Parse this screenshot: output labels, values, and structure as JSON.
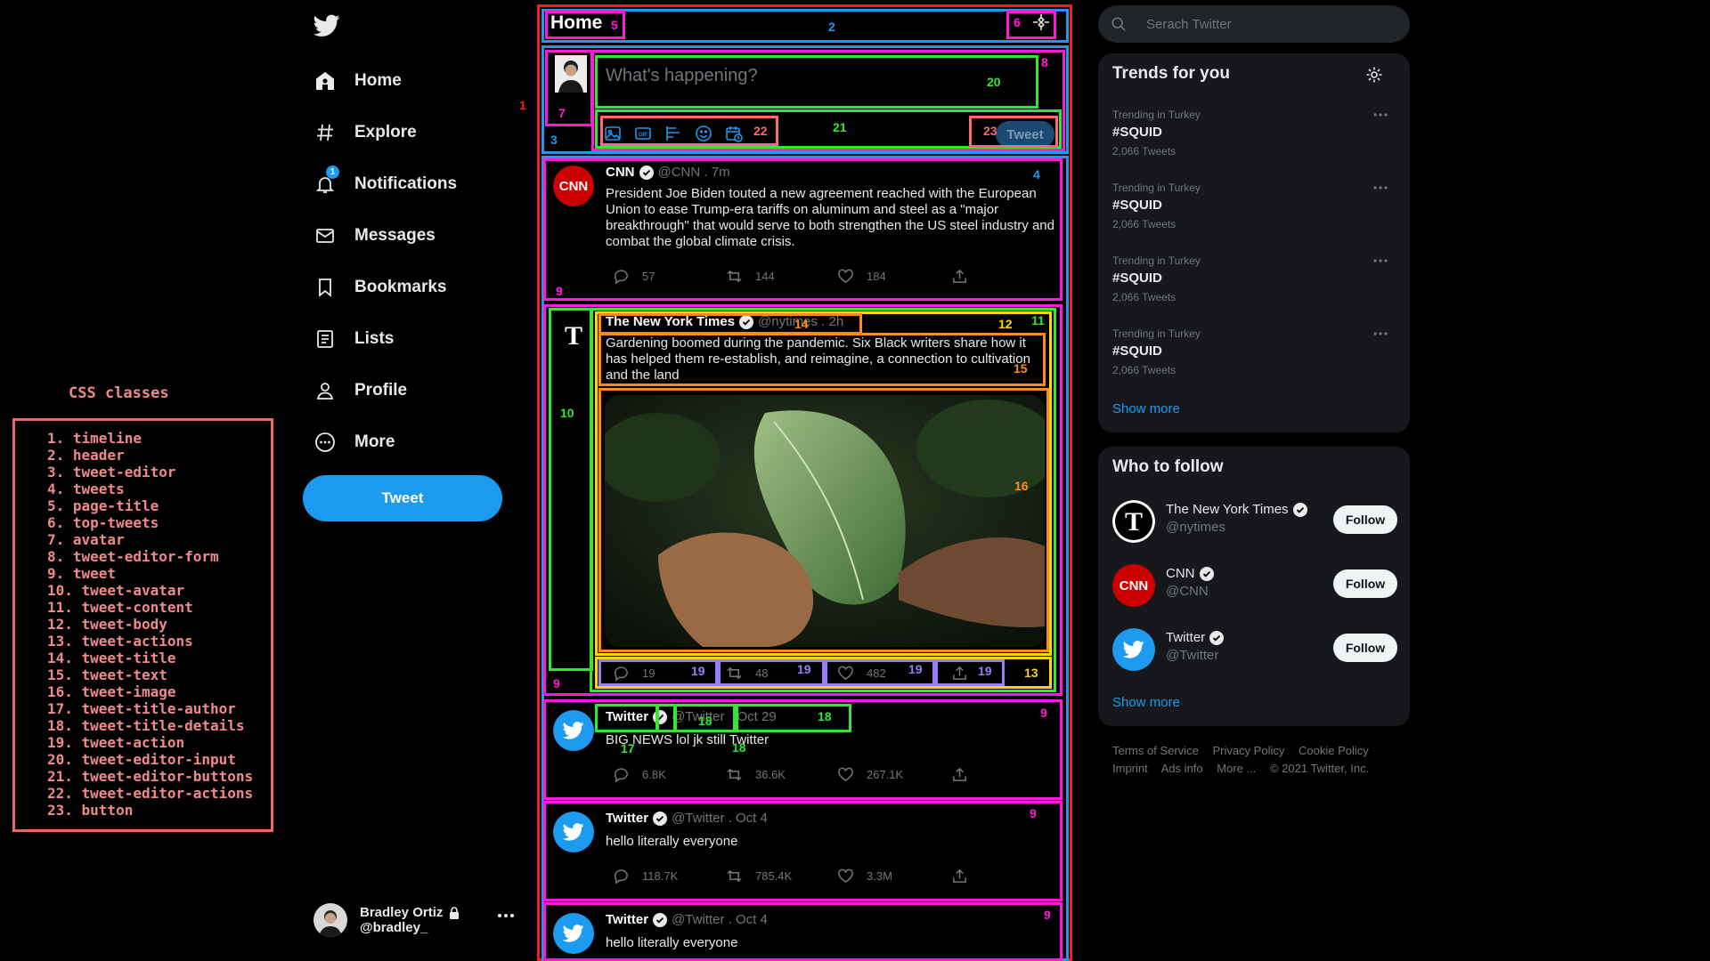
{
  "legend": {
    "title": "CSS classes",
    "items": [
      "1. timeline",
      "2. header",
      "3. tweet-editor",
      "4. tweets",
      "5. page-title",
      "6. top-tweets",
      "7. avatar",
      "8. tweet-editor-form",
      "9. tweet",
      "10. tweet-avatar",
      "11. tweet-content",
      "12. tweet-body",
      "13. tweet-actions",
      "14. tweet-title",
      "15. tweet-text",
      "16. tweet-image",
      "17. tweet-title-author",
      "18. tweet-title-details",
      "19. tweet-action",
      "20. tweet-editor-input",
      "21. tweet-editor-buttons",
      "22. tweet-editor-actions",
      "23. button"
    ]
  },
  "nav": {
    "items": [
      {
        "label": "Home",
        "icon": "home-icon"
      },
      {
        "label": "Explore",
        "icon": "hashtag-icon"
      },
      {
        "label": "Notifications",
        "icon": "bell-icon",
        "badge": "1"
      },
      {
        "label": "Messages",
        "icon": "envelope-icon"
      },
      {
        "label": "Bookmarks",
        "icon": "bookmark-icon"
      },
      {
        "label": "Lists",
        "icon": "list-icon"
      },
      {
        "label": "Profile",
        "icon": "person-icon"
      },
      {
        "label": "More",
        "icon": "more-circle-icon"
      }
    ],
    "tweet_button": "Tweet"
  },
  "account": {
    "name": "Bradley Ortiz",
    "handle": "@bradley_"
  },
  "header": {
    "title": "Home"
  },
  "editor": {
    "placeholder": "What's happening?",
    "tweet_button": "Tweet"
  },
  "tweets": [
    {
      "author": "CNN",
      "handle": "@CNN . 7m",
      "text": "President Joe Biden touted a new agreement reached with the European Union to ease Trump-era tariffs on aluminum and steel as a \"major breakthrough\" that would serve to both strengthen the US steel industry and combat the global climate crisis.",
      "replies": "57",
      "retweets": "144",
      "likes": "184"
    },
    {
      "author": "The New York Times",
      "handle": "@nytimes . 2h",
      "text": "Gardening boomed during the pandemic. Six Black writers share how it has helped them re-establish, and reimagine, a connection to cultivation and the land",
      "replies": "19",
      "retweets": "48",
      "likes": "482"
    },
    {
      "author": "Twitter",
      "handle": "@Twitter",
      "date": "Oct 29",
      "text": "BIG NEWS lol jk still Twitter",
      "replies": "6.8K",
      "retweets": "36.6K",
      "likes": "267.1K"
    },
    {
      "author": "Twitter",
      "handle": "@Twitter . Oct 4",
      "text": "hello literally everyone",
      "replies": "118.7K",
      "retweets": "785.4K",
      "likes": "3.3M"
    },
    {
      "author": "Twitter",
      "handle": "@Twitter . Oct 4",
      "text": "hello literally everyone"
    }
  ],
  "search": {
    "placeholder": "Serach Twitter"
  },
  "trends": {
    "title": "Trends for you",
    "items": [
      {
        "context": "Trending in Turkey",
        "tag": "#SQUID",
        "count": "2,066 Tweets"
      },
      {
        "context": "Trending in Turkey",
        "tag": "#SQUID",
        "count": "2,066 Tweets"
      },
      {
        "context": "Trending in Turkey",
        "tag": "#SQUID",
        "count": "2,066 Tweets"
      },
      {
        "context": "Trending in Turkey",
        "tag": "#SQUID",
        "count": "2,066 Tweets"
      }
    ],
    "show_more": "Show more"
  },
  "who_to_follow": {
    "title": "Who to follow",
    "items": [
      {
        "name": "The New York Times",
        "handle": "@nytimes",
        "button": "Follow"
      },
      {
        "name": "CNN",
        "handle": "@CNN",
        "button": "Follow"
      },
      {
        "name": "Twitter",
        "handle": "@Twitter",
        "button": "Follow"
      }
    ],
    "show_more": "Show more"
  },
  "footer": {
    "links": [
      "Terms of Service",
      "Privacy Policy",
      "Cookie Policy",
      "Imprint",
      "Ads info",
      "More ...",
      "© 2021 Twitter, Inc."
    ]
  },
  "annotations": [
    "1",
    "2",
    "3",
    "4",
    "5",
    "6",
    "7",
    "8",
    "9",
    "10",
    "11",
    "12",
    "13",
    "14",
    "15",
    "16",
    "17",
    "18",
    "19",
    "20",
    "21",
    "22",
    "23"
  ],
  "colors": {
    "background": "#000000",
    "accent": "#1d9bf0",
    "panel": "#16181c",
    "outline_red": "#ff1a1a",
    "outline_blue": "#2196f3",
    "outline_magenta": "#ff1ad9",
    "outline_green": "#33e633",
    "outline_orange": "#ff8c1a",
    "outline_yellow": "#ffd21a",
    "outline_purple": "#9a7cff",
    "outline_salmon": "#ff6b6b"
  }
}
